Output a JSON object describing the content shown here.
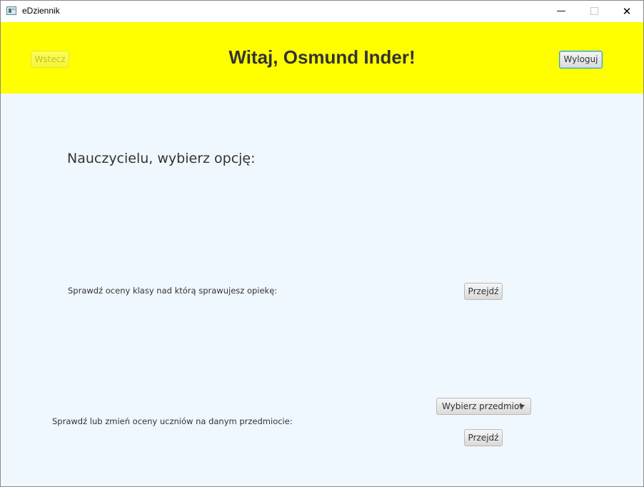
{
  "window": {
    "title": "eDziennik"
  },
  "window_controls": {
    "minimize": "—",
    "close": "✕"
  },
  "header": {
    "back_label": "Wstecz",
    "welcome": "Witaj, Osmund Inder!",
    "logout_label": "Wyloguj",
    "background": "#ffff00"
  },
  "main": {
    "prompt": "Nauczycielu, wybierz opcję:",
    "option1": {
      "label": "Sprawdź oceny klasy nad którą sprawujesz opiekę:",
      "button": "Przejdź"
    },
    "option2": {
      "label": "Sprawdź lub zmień oceny uczniów na danym przedmiocie:",
      "select_value": "Wybierz przedmiot",
      "button": "Przejdź"
    },
    "background": "#f0f8ff"
  }
}
